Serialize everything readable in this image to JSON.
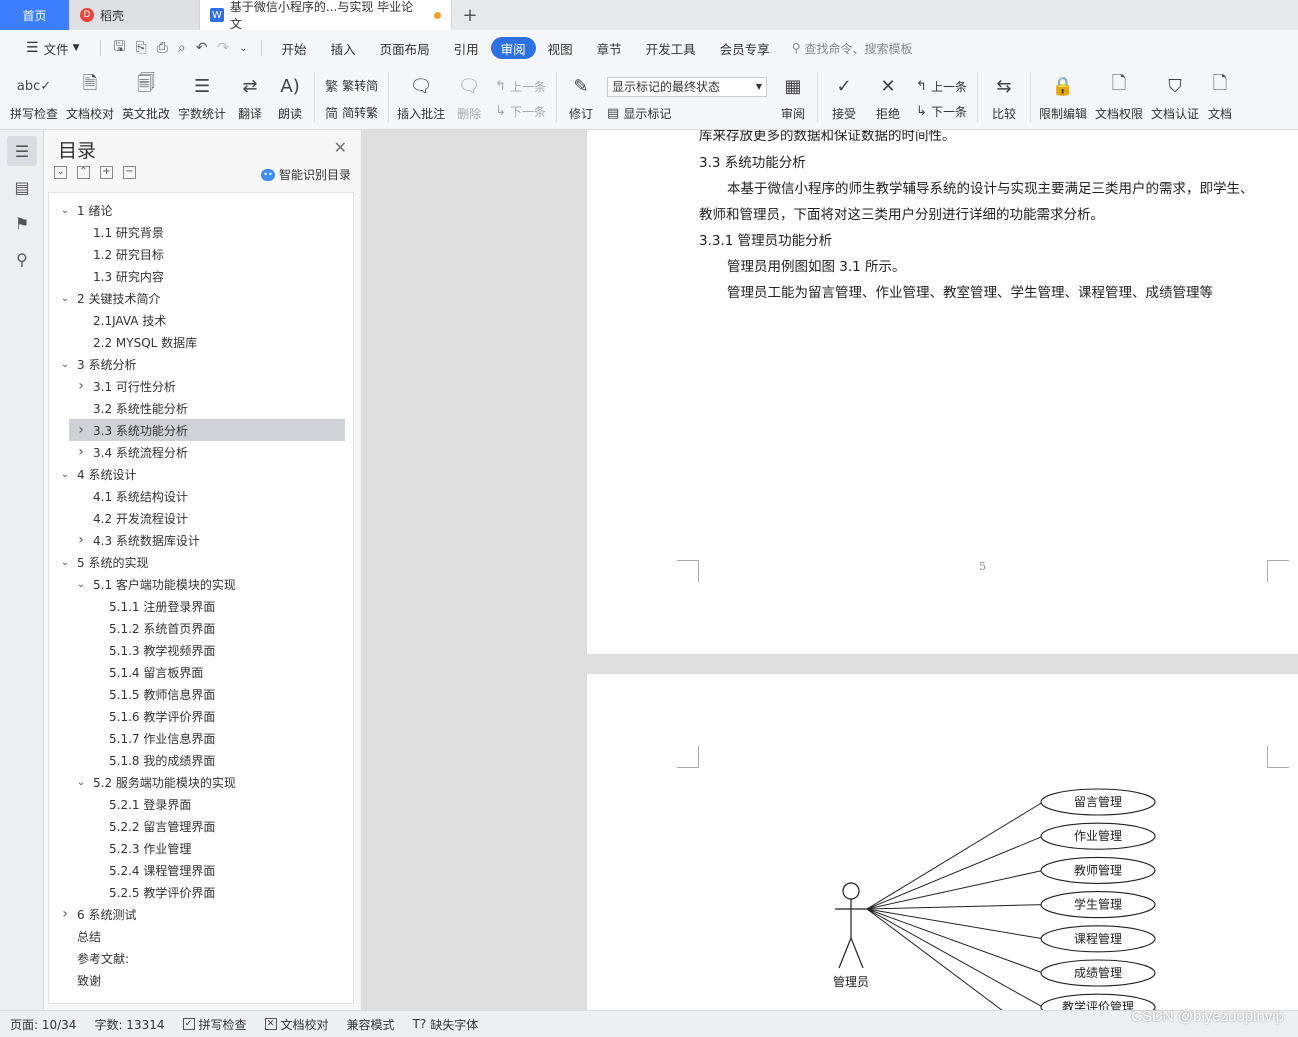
{
  "tabs": {
    "home": "首页",
    "daoke": "稻壳",
    "doc": "基于微信小程序的...与实现 毕业论文",
    "new_tab": "+"
  },
  "menu": {
    "file": "文件",
    "items": [
      "开始",
      "插入",
      "页面布局",
      "引用",
      "审阅",
      "视图",
      "章节",
      "开发工具",
      "会员专享"
    ],
    "active": "审阅",
    "search": "查找命令、搜索模板"
  },
  "ribbon": {
    "spell": "拼写检查",
    "doc_check": "文档校对",
    "en_review": "英文批改",
    "word_count": "字数统计",
    "translate": "翻译",
    "read_aloud": "朗读",
    "trad": "繁转简",
    "simp": "简转繁",
    "insert_comment": "插入批注",
    "delete": "删除",
    "prev": "上一条",
    "next": "下一条",
    "revise": "修订",
    "markup_state": "显示标记的最终状态",
    "show_markup": "显示标记",
    "review": "审阅",
    "accept": "接受",
    "reject": "拒绝",
    "prev2": "上一条",
    "next2": "下一条",
    "compare": "比较",
    "restrict": "限制编辑",
    "permission": "文档权限",
    "certify": "文档认证",
    "more": "文档"
  },
  "toc": {
    "title": "目录",
    "smart": "智能识别目录",
    "items": [
      {
        "label": "1  绪论",
        "level": 0,
        "arrow": "down"
      },
      {
        "label": "1.1 研究背景",
        "level": 1,
        "arrow": ""
      },
      {
        "label": "1.2 研究目标",
        "level": 1,
        "arrow": ""
      },
      {
        "label": "1.3 研究内容",
        "level": 1,
        "arrow": ""
      },
      {
        "label": "2  关键技术简介",
        "level": 0,
        "arrow": "down"
      },
      {
        "label": "2.1JAVA 技术",
        "level": 1,
        "arrow": ""
      },
      {
        "label": "2.2 MYSQL 数据库",
        "level": 1,
        "arrow": ""
      },
      {
        "label": "3  系统分析",
        "level": 0,
        "arrow": "down"
      },
      {
        "label": "3.1 可行性分析",
        "level": 1,
        "arrow": "right"
      },
      {
        "label": "3.2 系统性能分析",
        "level": 1,
        "arrow": ""
      },
      {
        "label": "3.3 系统功能分析",
        "level": 1,
        "arrow": "right",
        "selected": true
      },
      {
        "label": "3.4 系统流程分析",
        "level": 1,
        "arrow": "right"
      },
      {
        "label": "4  系统设计",
        "level": 0,
        "arrow": "down"
      },
      {
        "label": "4.1 系统结构设计",
        "level": 1,
        "arrow": ""
      },
      {
        "label": "4.2 开发流程设计",
        "level": 1,
        "arrow": ""
      },
      {
        "label": "4.3 系统数据库设计",
        "level": 1,
        "arrow": "right"
      },
      {
        "label": "5  系统的实现",
        "level": 0,
        "arrow": "down"
      },
      {
        "label": "5.1 客户端功能模块的实现",
        "level": 1,
        "arrow": "down"
      },
      {
        "label": "5.1.1 注册登录界面",
        "level": 2,
        "arrow": ""
      },
      {
        "label": "5.1.2 系统首页界面",
        "level": 2,
        "arrow": ""
      },
      {
        "label": "5.1.3 教学视频界面",
        "level": 2,
        "arrow": ""
      },
      {
        "label": "5.1.4 留言板界面",
        "level": 2,
        "arrow": ""
      },
      {
        "label": "5.1.5 教师信息界面",
        "level": 2,
        "arrow": ""
      },
      {
        "label": "5.1.6 教学评价界面",
        "level": 2,
        "arrow": ""
      },
      {
        "label": "5.1.7 作业信息界面",
        "level": 2,
        "arrow": ""
      },
      {
        "label": "5.1.8 我的成绩界面",
        "level": 2,
        "arrow": ""
      },
      {
        "label": "5.2 服务端功能模块的实现",
        "level": 1,
        "arrow": "down"
      },
      {
        "label": "5.2.1 登录界面",
        "level": 2,
        "arrow": ""
      },
      {
        "label": "5.2.2 留言管理界面",
        "level": 2,
        "arrow": ""
      },
      {
        "label": "5.2.3 作业管理",
        "level": 2,
        "arrow": ""
      },
      {
        "label": "5.2.4 课程管理界面",
        "level": 2,
        "arrow": ""
      },
      {
        "label": "5.2.5 教学评价界面",
        "level": 2,
        "arrow": ""
      },
      {
        "label": "6  系统测试",
        "level": 0,
        "arrow": "right"
      },
      {
        "label": "总结",
        "level": 0,
        "arrow": ""
      },
      {
        "label": "参考文献:",
        "level": 0,
        "arrow": ""
      },
      {
        "label": "致谢",
        "level": 0,
        "arrow": ""
      }
    ]
  },
  "document": {
    "partial_line": "库来存放更多的数据和保证数据的时间性。",
    "heading_33": "3.3 系统功能分析",
    "para1_line1": "本基于微信小程序的师生教学辅导系统的设计与实现主要满足三类用户的需求，即学生、",
    "para1_line2": "教师和管理员，下面将对这三类用户分别进行详细的功能需求分析。",
    "heading_331": "3.3.1 管理员功能分析",
    "para2": "管理员用例图如图 3.1 所示。",
    "para3": "管理员工能为留言管理、作业管理、教室管理、学生管理、课程管理、成绩管理等",
    "page_number": "5",
    "diagram": {
      "actor": "管理员",
      "use_cases": [
        "留言管理",
        "作业管理",
        "教师管理",
        "学生管理",
        "课程管理",
        "成绩管理",
        "教学评价管理"
      ]
    }
  },
  "status": {
    "page": "页面: 10/34",
    "words": "字数: 13314",
    "spell": "拼写检查",
    "doc_check": "文档校对",
    "compat": "兼容模式",
    "missing_font": "缺失字体"
  },
  "watermark": "CSDN @biyezuopinvip"
}
